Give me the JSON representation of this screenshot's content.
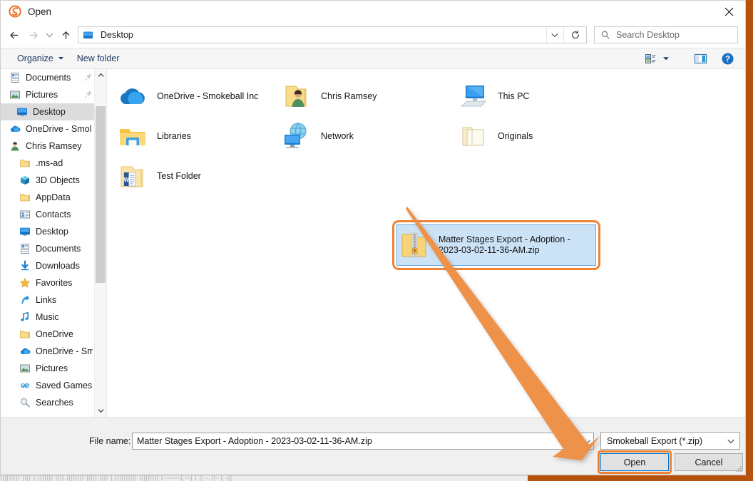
{
  "window": {
    "title": "Open",
    "logo_icon": "smokeball-logo-icon",
    "close_icon": "close-icon"
  },
  "nav": {
    "back_icon": "arrow-left-icon",
    "forward_icon": "arrow-right-icon",
    "recent_icon": "chevron-down-icon",
    "up_icon": "arrow-up-icon",
    "address": {
      "icon": "desktop-icon",
      "value": "Desktop",
      "dropdown_icon": "chevron-down-icon",
      "refresh_icon": "refresh-icon"
    },
    "search": {
      "icon": "search-icon",
      "placeholder": "Search Desktop"
    }
  },
  "commandbar": {
    "organize_label": "Organize",
    "organize_caret_icon": "caret-down-icon",
    "new_folder_label": "New folder",
    "view_icon": "view-layout-icon",
    "view_caret_icon": "caret-down-icon",
    "preview_pane_icon": "preview-pane-icon",
    "help_icon": "help-icon"
  },
  "sidebar": {
    "items": [
      {
        "label": "Documents",
        "icon": "documents-icon",
        "level": 1,
        "pinned": true,
        "selected": false
      },
      {
        "label": "Pictures",
        "icon": "pictures-icon",
        "level": 1,
        "pinned": true,
        "selected": false
      },
      {
        "label": "Desktop",
        "icon": "desktop-icon",
        "level": 0,
        "pinned": false,
        "selected": true
      },
      {
        "label": "OneDrive - Smol",
        "icon": "onedrive-icon",
        "level": 1,
        "pinned": false,
        "selected": false
      },
      {
        "label": "Chris Ramsey",
        "icon": "user-icon",
        "level": 1,
        "pinned": false,
        "selected": false
      },
      {
        "label": ".ms-ad",
        "icon": "folder-icon",
        "level": 2,
        "pinned": false,
        "selected": false
      },
      {
        "label": "3D Objects",
        "icon": "3d-objects-icon",
        "level": 2,
        "pinned": false,
        "selected": false
      },
      {
        "label": "AppData",
        "icon": "folder-icon",
        "level": 2,
        "pinned": false,
        "selected": false
      },
      {
        "label": "Contacts",
        "icon": "contacts-icon",
        "level": 2,
        "pinned": false,
        "selected": false
      },
      {
        "label": "Desktop",
        "icon": "desktop-icon",
        "level": 2,
        "pinned": false,
        "selected": false
      },
      {
        "label": "Documents",
        "icon": "documents-icon",
        "level": 2,
        "pinned": false,
        "selected": false
      },
      {
        "label": "Downloads",
        "icon": "downloads-icon",
        "level": 2,
        "pinned": false,
        "selected": false
      },
      {
        "label": "Favorites",
        "icon": "favorites-icon",
        "level": 2,
        "pinned": false,
        "selected": false
      },
      {
        "label": "Links",
        "icon": "links-icon",
        "level": 2,
        "pinned": false,
        "selected": false
      },
      {
        "label": "Music",
        "icon": "music-icon",
        "level": 2,
        "pinned": false,
        "selected": false
      },
      {
        "label": "OneDrive",
        "icon": "folder-icon",
        "level": 2,
        "pinned": false,
        "selected": false
      },
      {
        "label": "OneDrive - Sm",
        "icon": "onedrive-icon",
        "level": 2,
        "pinned": false,
        "selected": false
      },
      {
        "label": "Pictures",
        "icon": "pictures-icon",
        "level": 2,
        "pinned": false,
        "selected": false
      },
      {
        "label": "Saved Games",
        "icon": "saved-games-icon",
        "level": 2,
        "pinned": false,
        "selected": false
      },
      {
        "label": "Searches",
        "icon": "searches-icon",
        "level": 2,
        "pinned": false,
        "selected": false
      }
    ],
    "scroll_up_icon": "chevron-up-icon",
    "scroll_down_icon": "chevron-down-icon"
  },
  "files": [
    {
      "label": "OneDrive - Smokeball Inc",
      "icon": "onedrive-cloud-icon",
      "col": 0,
      "row": 0,
      "selected": false
    },
    {
      "label": "Libraries",
      "icon": "libraries-icon",
      "col": 0,
      "row": 1,
      "selected": false
    },
    {
      "label": "Test Folder",
      "icon": "word-folder-icon",
      "col": 0,
      "row": 2,
      "selected": false
    },
    {
      "label": "Chris Ramsey",
      "icon": "user-folder-icon",
      "col": 1,
      "row": 0,
      "selected": false
    },
    {
      "label": "Network",
      "icon": "network-icon",
      "col": 1,
      "row": 1,
      "selected": false
    },
    {
      "label": "This PC",
      "icon": "this-pc-icon",
      "col": 2,
      "row": 0,
      "selected": false
    },
    {
      "label": "Originals",
      "icon": "folder-open-icon",
      "col": 2,
      "row": 1,
      "selected": false
    }
  ],
  "selected_file": {
    "line1": "Matter Stages Export - Adoption -",
    "line2": "2023-03-02-11-36-AM.zip",
    "icon": "zip-folder-icon"
  },
  "footer": {
    "filename_label": "File name:",
    "filename_value": "Matter Stages Export - Adoption - 2023-03-02-11-36-AM.zip",
    "filename_dropdown_icon": "chevron-down-icon",
    "filter_value": "Smokeball Export (*.zip)",
    "filter_dropdown_icon": "chevron-down-icon",
    "open_label": "Open",
    "cancel_label": "Cancel",
    "resize_grip_icon": "resize-grip-icon"
  },
  "annotation": {
    "arrow_icon": "pointer-arrow-icon",
    "color": "#ef9248",
    "highlight_color": "#ed8333"
  },
  "background": {
    "bottom_text": "|||[||[|| |||| |.|||||||     ||||.|||||||| |||||.||||                              |.||||||||||  ||||||||| (------|.--| |.||.-.||- |.-||"
  }
}
